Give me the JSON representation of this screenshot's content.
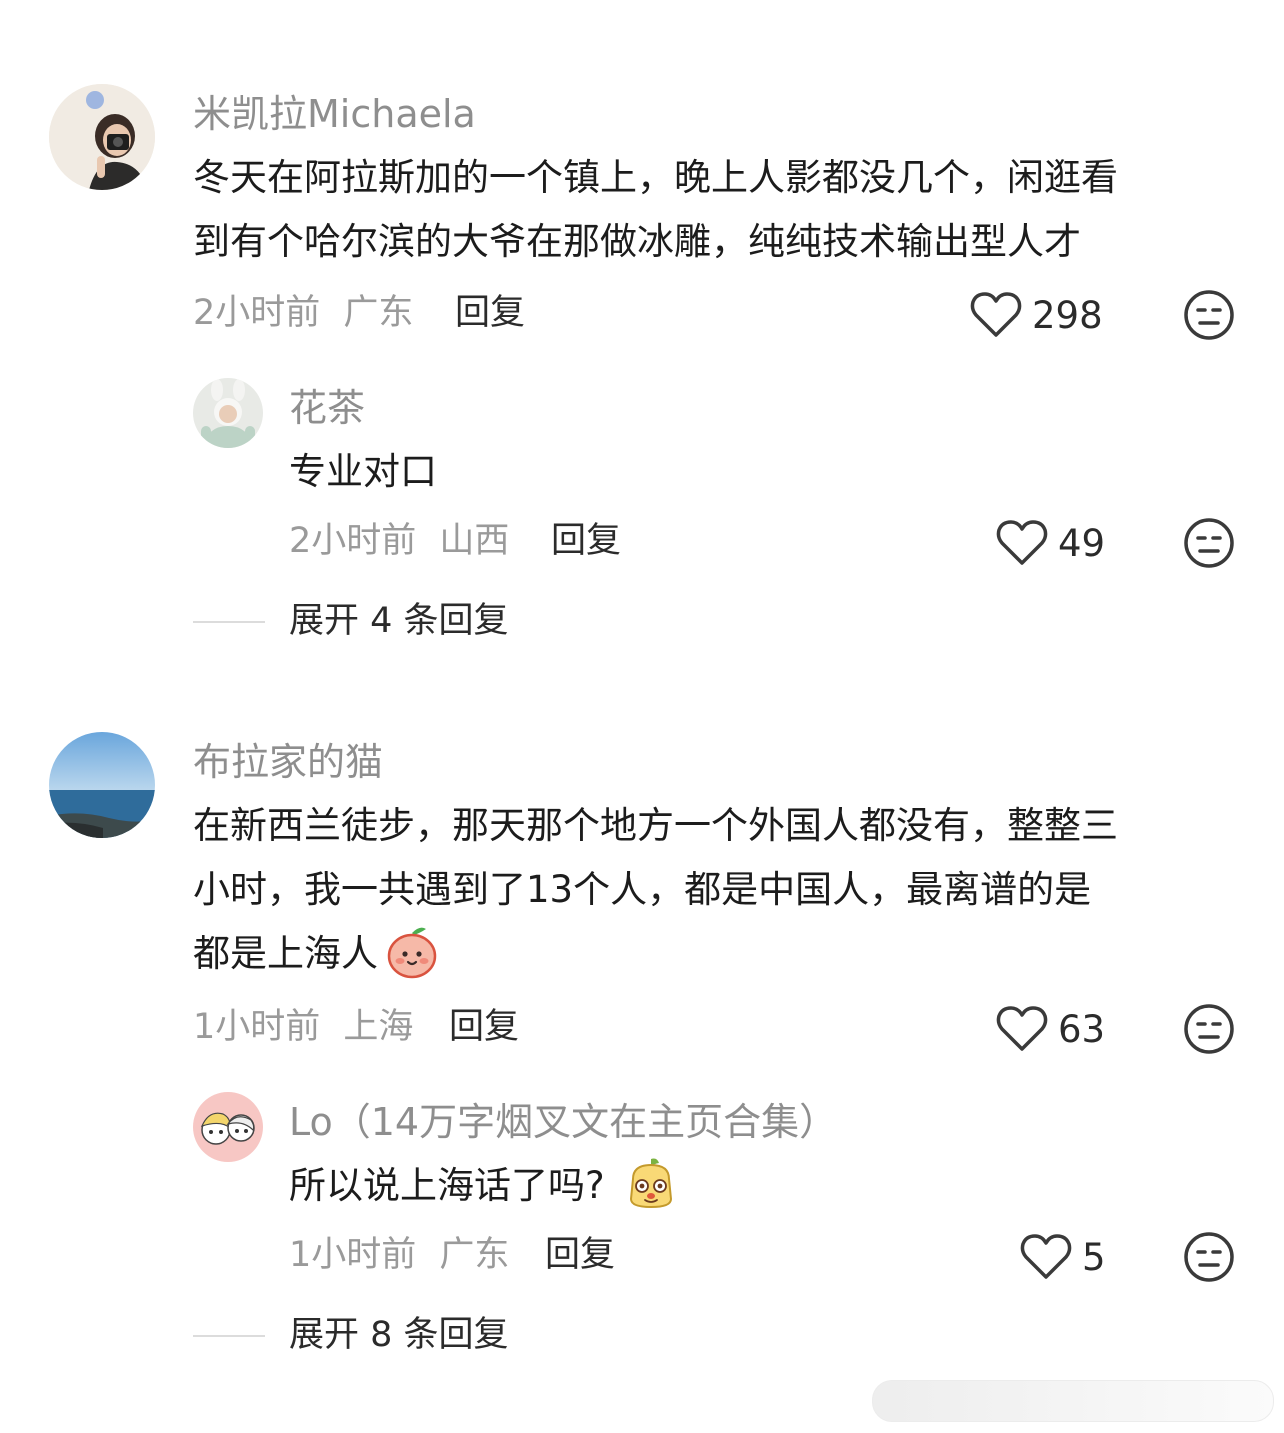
{
  "comments": [
    {
      "username": "米凯拉Michaela",
      "text_line1": "冬天在阿拉斯加的一个镇上，晚上人影都没几个，闲逛看",
      "text_line2": "到有个哈尔滨的大爷在那做冰雕，纯纯技术输出型人才",
      "time": "2小时前",
      "location": "广东",
      "reply_label": "回复",
      "likes": "298",
      "replies": [
        {
          "username": "花茶",
          "text": "专业对口",
          "time": "2小时前",
          "location": "山西",
          "reply_label": "回复",
          "likes": "49"
        }
      ],
      "expand_label": "展开 4 条回复"
    },
    {
      "username": "布拉家的猫",
      "text_line1": "在新西兰徒步，那天那个地方一个外国人都没有，整整三",
      "text_line2": "小时，我一共遇到了13个人，都是中国人，最离谱的是",
      "text_line3": "都是上海人",
      "time": "1小时前",
      "location": "上海",
      "reply_label": "回复",
      "likes": "63",
      "replies": [
        {
          "username": "Lo（14万字烟叉文在主页合集）",
          "text": "所以说上海话了吗?",
          "time": "1小时前",
          "location": "广东",
          "reply_label": "回复",
          "likes": "5"
        }
      ],
      "expand_label": "展开 8 条回复"
    }
  ],
  "icons": {
    "like": "heart-outline-icon",
    "more": "neutral-face-icon",
    "emoji_peach": "peach-smile-emoji",
    "emoji_dog": "puppy-emoji"
  },
  "colors": {
    "username": "#8e8e8e",
    "meta": "#9a9a9a",
    "text": "#1c1c1c"
  }
}
